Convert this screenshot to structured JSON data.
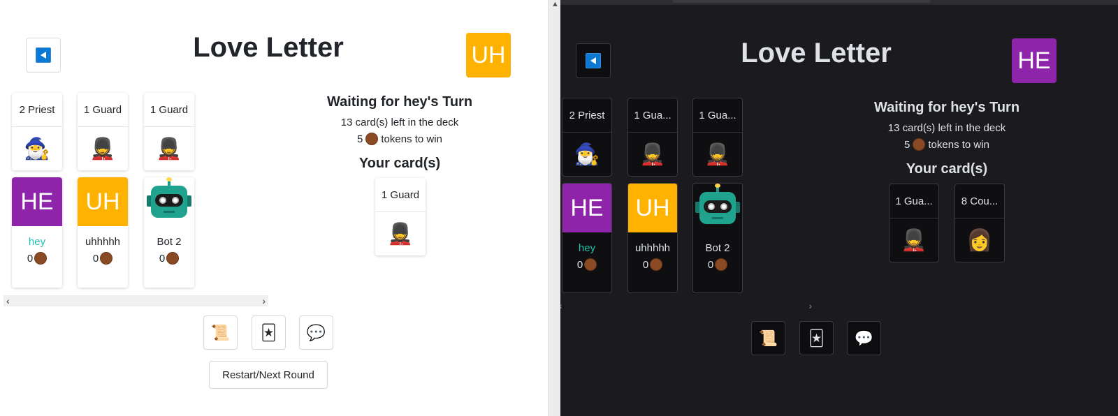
{
  "light": {
    "title": "Love Letter",
    "user_avatar": {
      "initials": "UH",
      "color": "#ffb300"
    },
    "played_cards": [
      {
        "label": "2 Priest",
        "emoji": "🧙‍♂️"
      },
      {
        "label": "1 Guard",
        "emoji": "💂"
      },
      {
        "label": "1 Guard",
        "emoji": "💂"
      }
    ],
    "players": [
      {
        "name": "hey",
        "initials": "HE",
        "color": "#8e24aa",
        "tokens": "0",
        "active": true
      },
      {
        "name": "uhhhhh",
        "initials": "UH",
        "color": "#ffb300",
        "tokens": "0",
        "active": false
      },
      {
        "name": "Bot 2",
        "robot": true,
        "tokens": "0",
        "active": false
      }
    ],
    "status": {
      "waiting": "Waiting for hey's Turn",
      "deck": "13 card(s) left in the deck",
      "tokens_to_win": "5",
      "tokens_suffix": "tokens to win",
      "your_cards_title": "Your card(s)"
    },
    "your_cards": [
      {
        "label": "1 Guard",
        "emoji": "💂"
      }
    ],
    "toolbar": {
      "rules_icon": "📜",
      "cards_icon": "🃏",
      "chat_icon": "💬"
    },
    "restart_label": "Restart/Next Round",
    "scroll_left": "‹",
    "scroll_right": "›"
  },
  "dark": {
    "title": "Love Letter",
    "user_avatar": {
      "initials": "HE",
      "color": "#8e24aa"
    },
    "played_cards": [
      {
        "label": "2 Priest",
        "emoji": "🧙‍♂️"
      },
      {
        "label": "1 Gua...",
        "emoji": "💂"
      },
      {
        "label": "1 Gua...",
        "emoji": "💂"
      }
    ],
    "players": [
      {
        "name": "hey",
        "initials": "HE",
        "color": "#8e24aa",
        "tokens": "0",
        "active": true
      },
      {
        "name": "uhhhhh",
        "initials": "UH",
        "color": "#ffb300",
        "tokens": "0",
        "active": false
      },
      {
        "name": "Bot 2",
        "robot": true,
        "tokens": "0",
        "active": false
      }
    ],
    "status": {
      "waiting": "Waiting for hey's Turn",
      "deck": "13 card(s) left in the deck",
      "tokens_to_win": "5",
      "tokens_suffix": "tokens to win",
      "your_cards_title": "Your card(s)"
    },
    "your_cards": [
      {
        "label": "1 Gua...",
        "emoji": "💂"
      },
      {
        "label": "8 Cou...",
        "emoji": "👩"
      }
    ],
    "toolbar": {
      "rules_icon": "📜",
      "cards_icon": "🃏",
      "chat_icon": "💬"
    },
    "scroll_left": "‹",
    "scroll_right": "›"
  },
  "divider_arrow": "▲"
}
